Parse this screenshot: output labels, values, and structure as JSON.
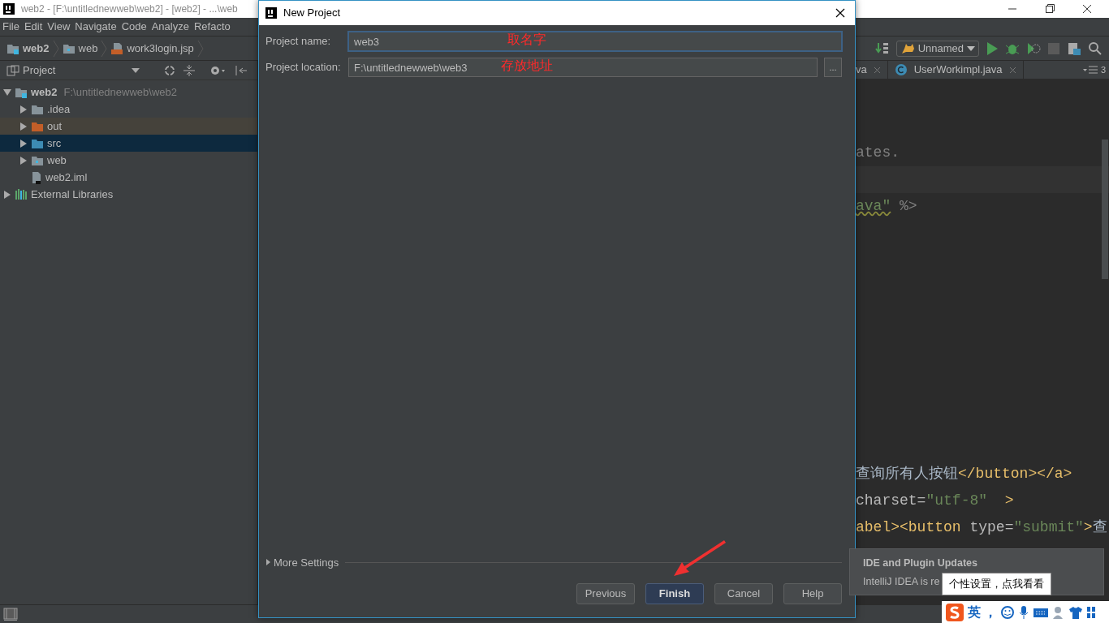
{
  "window": {
    "title": "web2 - [F:\\untitlednewweb\\web2] - [web2] - ...\\web"
  },
  "menu": [
    "File",
    "Edit",
    "View",
    "Navigate",
    "Code",
    "Analyze",
    "Refacto"
  ],
  "breadcrumb": [
    {
      "label": "web2",
      "kind": "module"
    },
    {
      "label": "web",
      "kind": "web"
    },
    {
      "label": "work3login.jsp",
      "kind": "jsp"
    }
  ],
  "run_config": {
    "label": "Unnamed"
  },
  "project_panel": {
    "title": "Project"
  },
  "tree": [
    {
      "label": "web2",
      "path": "F:\\untitlednewweb\\web2",
      "kind": "module",
      "expanded": true,
      "selected": false,
      "children": [
        {
          "label": ".idea",
          "kind": "folder",
          "expanded": false,
          "selected": false,
          "excluded": false
        },
        {
          "label": "out",
          "kind": "folder",
          "expanded": false,
          "selected": false,
          "excluded": true
        },
        {
          "label": "src",
          "kind": "source",
          "expanded": false,
          "selected": true,
          "excluded": false
        },
        {
          "label": "web",
          "kind": "web",
          "expanded": false,
          "selected": false,
          "excluded": false
        },
        {
          "label": "web2.iml",
          "kind": "file",
          "selected": false,
          "excluded": false
        }
      ]
    },
    {
      "label": "External Libraries",
      "kind": "library",
      "expanded": false,
      "selected": false
    }
  ],
  "editor_tabs": [
    {
      "label": "va",
      "kind": "partial",
      "selected": false
    },
    {
      "label": "UserWorkimpl.java",
      "kind": "class",
      "selected": false
    }
  ],
  "tab_count": "3",
  "code_lines": [
    {
      "kind": "blank"
    },
    {
      "kind": "blank"
    },
    {
      "kind": "code",
      "tokens": [
        {
          "text": "ates.",
          "kind": "comment"
        }
      ]
    },
    {
      "kind": "current"
    },
    {
      "kind": "code",
      "tokens": [
        {
          "text": "ava\"",
          "kind": "string"
        },
        {
          "text": " %>",
          "kind": "comment"
        }
      ]
    },
    {
      "kind": "blank"
    },
    {
      "kind": "blank"
    },
    {
      "kind": "blank"
    },
    {
      "kind": "blank"
    },
    {
      "kind": "blank"
    },
    {
      "kind": "blank"
    },
    {
      "kind": "blank"
    },
    {
      "kind": "blank"
    },
    {
      "kind": "blank"
    },
    {
      "kind": "code",
      "tokens": [
        {
          "text": "查询所有人按钮",
          "kind": "plain"
        },
        {
          "text": "</button></a>",
          "kind": "tag"
        }
      ]
    },
    {
      "kind": "code",
      "tokens": [
        {
          "text": "charset=",
          "kind": "attr"
        },
        {
          "text": "\"utf-8\"",
          "kind": "string"
        },
        {
          "text": "  >",
          "kind": "tag"
        }
      ]
    },
    {
      "kind": "code",
      "tokens": [
        {
          "text": "abel><button",
          "kind": "tag"
        },
        {
          "text": " type=",
          "kind": "attr"
        },
        {
          "text": "\"submit\"",
          "kind": "string"
        },
        {
          "text": ">",
          "kind": "tag"
        },
        {
          "text": "查",
          "kind": "plain"
        }
      ]
    }
  ],
  "dialog": {
    "title": "New Project",
    "fields": [
      {
        "label": "Project name:",
        "value": "web3",
        "focused": true,
        "note": "取名字"
      },
      {
        "label": "Project location:",
        "value": "F:\\untitlednewweb\\web3",
        "browse": "...",
        "focused": false,
        "note": "存放地址"
      }
    ],
    "more_settings": {
      "label": "More Settings",
      "expanded": false
    },
    "buttons": [
      {
        "label": "Previous",
        "default": false
      },
      {
        "label": "Finish",
        "default": true
      },
      {
        "label": "Cancel",
        "default": false
      },
      {
        "label": "Help",
        "default": false
      }
    ]
  },
  "notification": {
    "title": "IDE and Plugin Updates",
    "text": "IntelliJ IDEA is re"
  },
  "tooltip": {
    "text": "个性设置，点我看看"
  },
  "ime": {
    "labels": [
      "英",
      "，"
    ]
  }
}
